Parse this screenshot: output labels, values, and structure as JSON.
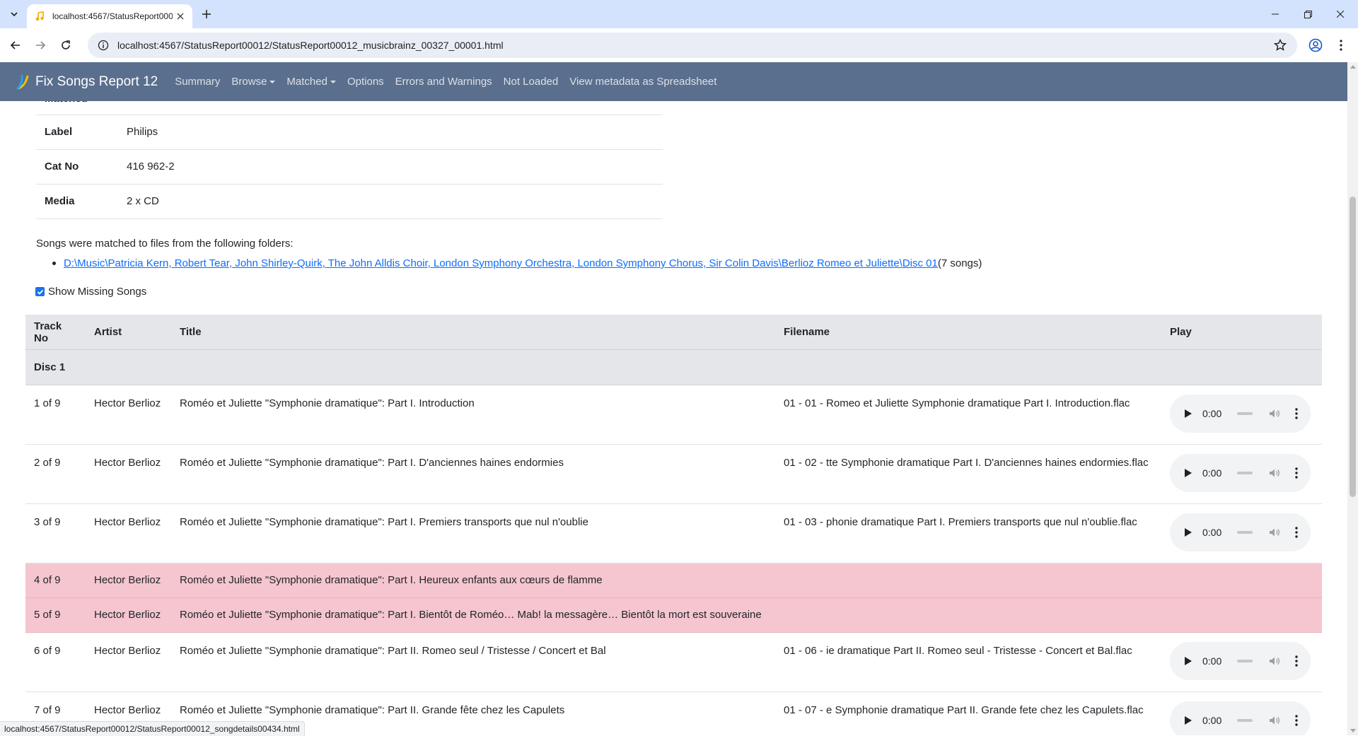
{
  "browser": {
    "tab_title": "localhost:4567/StatusReport000",
    "url": "localhost:4567/StatusReport00012/StatusReport00012_musicbrainz_00327_00001.html",
    "status_url": "localhost:4567/StatusReport00012/StatusReport00012_songdetails00434.html"
  },
  "navbar": {
    "brand": "Fix Songs Report 12",
    "links": {
      "summary": "Summary",
      "browse": "Browse",
      "matched": "Matched",
      "options": "Options",
      "errors": "Errors and Warnings",
      "not_loaded": "Not Loaded",
      "spreadsheet": "View metadata as Spreadsheet"
    }
  },
  "details": {
    "partial_label": "Matched",
    "rows": [
      {
        "key": "Label",
        "value": "Philips"
      },
      {
        "key": "Cat No",
        "value": "416 962-2"
      },
      {
        "key": "Media",
        "value": "2 x CD"
      }
    ]
  },
  "folders": {
    "intro": "Songs were matched to files from the following folders:",
    "items": [
      {
        "path": "D:\\Music\\Patricia Kern, Robert Tear, John Shirley-Quirk, The John Alldis Choir, London Symphony Orchestra, London Symphony Chorus, Sir Colin Davis\\Berlioz Romeo et Juliette\\Disc 01 ",
        "count": "(7 songs)"
      }
    ]
  },
  "show_missing": {
    "label": "Show Missing Songs",
    "checked": true
  },
  "songs": {
    "headers": {
      "track": "Track No",
      "artist": "Artist",
      "title": "Title",
      "filename": "Filename",
      "play": "Play"
    },
    "disc_label": "Disc 1",
    "rows": [
      {
        "track": "1 of 9",
        "artist": "Hector Berlioz",
        "title": "Roméo et Juliette \"Symphonie dramatique\": Part I. Introduction",
        "filename": "01 - 01 - Romeo et Juliette Symphonie dramatique Part I. Introduction.flac",
        "time": "0:00",
        "missing": false
      },
      {
        "track": "2 of 9",
        "artist": "Hector Berlioz",
        "title": "Roméo et Juliette \"Symphonie dramatique\": Part I. D'anciennes haines endormies",
        "filename": "01 - 02 - tte Symphonie dramatique Part I. D'anciennes haines endormies.flac",
        "time": "0:00",
        "missing": false
      },
      {
        "track": "3 of 9",
        "artist": "Hector Berlioz",
        "title": "Roméo et Juliette \"Symphonie dramatique\": Part I. Premiers transports que nul n'oublie",
        "filename": "01 - 03 - phonie dramatique Part I. Premiers transports que nul n'oublie.flac",
        "time": "0:00",
        "missing": false
      },
      {
        "track": "4 of 9",
        "artist": "Hector Berlioz",
        "title": "Roméo et Juliette \"Symphonie dramatique\": Part I. Heureux enfants aux cœurs de flamme",
        "filename": "",
        "time": "",
        "missing": true
      },
      {
        "track": "5 of 9",
        "artist": "Hector Berlioz",
        "title": "Roméo et Juliette \"Symphonie dramatique\": Part I. Bientôt de Roméo… Mab! la messagère… Bientôt la mort est souveraine",
        "filename": "",
        "time": "",
        "missing": true
      },
      {
        "track": "6 of 9",
        "artist": "Hector Berlioz",
        "title": "Roméo et Juliette \"Symphonie dramatique\": Part II. Romeo seul / Tristesse / Concert et Bal",
        "filename": "01 - 06 - ie dramatique Part II. Romeo seul - Tristesse - Concert et Bal.flac",
        "time": "0:00",
        "missing": false
      },
      {
        "track": "7 of 9",
        "artist": "Hector Berlioz",
        "title": "Roméo et Juliette \"Symphonie dramatique\": Part II. Grande fête chez les Capulets",
        "filename": "01 - 07 - e Symphonie dramatique Part II. Grande fete chez les Capulets.flac",
        "time": "0:00",
        "missing": false
      }
    ]
  },
  "colors": {
    "navbar_bg": "#5a6f8e",
    "missing_row_bg": "#f5c6cf",
    "link": "#0d6efd",
    "tabstrip_bg": "#d3e3fd"
  }
}
